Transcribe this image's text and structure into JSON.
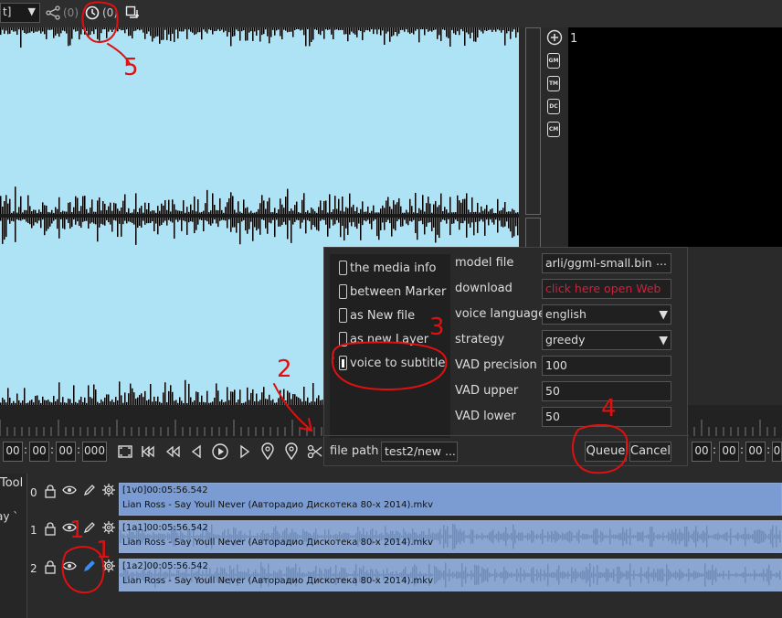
{
  "toolbar": {
    "combo_value": "t]",
    "link_count": "(0)",
    "history_count": "(0)"
  },
  "sidebar": {
    "plus_label": "1",
    "gm": "GM",
    "tm": "TM",
    "dc": "DC",
    "cm": "CM"
  },
  "timecode_left": [
    "00",
    "00",
    "00",
    "000"
  ],
  "timecode_right": [
    "00",
    "00",
    "00",
    "0"
  ],
  "dialog": {
    "options": [
      {
        "label": "the media info"
      },
      {
        "label": "between Marker"
      },
      {
        "label": "as New file"
      },
      {
        "label": "as new Layer"
      },
      {
        "label": "voice to subtitle"
      }
    ],
    "fields": {
      "model_file": {
        "label": "model file",
        "value": "arli/ggml-small.bin",
        "button": "..."
      },
      "download": {
        "label": "download",
        "value": "click here open Web"
      },
      "voice_language": {
        "label": "voice language",
        "value": "english"
      },
      "strategy": {
        "label": "strategy",
        "value": "greedy"
      },
      "vad_precision": {
        "label": "VAD precision",
        "value": "100"
      },
      "vad_upper": {
        "label": "VAD upper",
        "value": "50"
      },
      "vad_lower": {
        "label": "VAD lower",
        "value": "50"
      }
    },
    "file_path_label": "file path",
    "file_path_value": "test2/new ...",
    "queue_label": "Queue",
    "cancel_label": "Cancel"
  },
  "tracks_panel": {
    "tool_label": "Tool",
    "side_label": "ay `",
    "tracks": [
      {
        "num": "0",
        "line1": "[1v0]00:05:56.542",
        "line2": "Lian Ross - Say Youll Never (Авторадио Дискотека 80-х 2014).mkv"
      },
      {
        "num": "1",
        "line1": "[1a1]00:05:56.542",
        "line2": "Lian Ross - Say Youll Never (Авторадио Дискотека 80-х 2014).mkv"
      },
      {
        "num": "2",
        "line1": "[1a2]00:05:56.542",
        "line2": "Lian Ross - Say Youll Never (Авторадио Дискотека 80-х 2014).mkv"
      }
    ]
  },
  "annotations": {
    "n1a": "1",
    "n1b": "1",
    "n2": "2",
    "n3": "3",
    "n4": "4",
    "n5": "5"
  },
  "colors": {
    "wave_bg": "#aee2f5",
    "track_video": "#7a9cd2",
    "track_audio": "#8ba6d0",
    "annotation": "#e01010",
    "download_link": "#d0203a",
    "edit_active": "#3b8cf0"
  }
}
